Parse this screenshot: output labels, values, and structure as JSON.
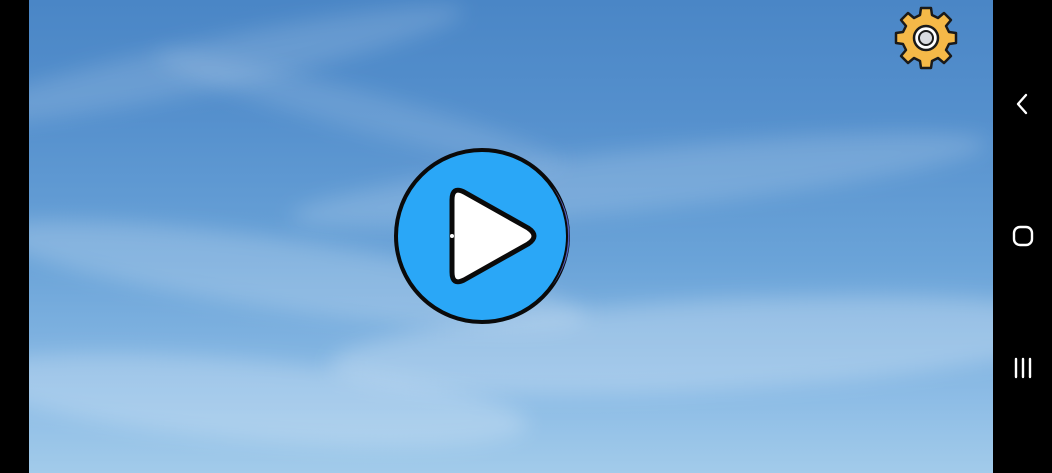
{
  "screen": {
    "background": "sky-with-clouds",
    "accent": "#2aa7f7"
  },
  "main": {
    "play_button": {
      "icon": "play-icon",
      "color": "#2aa7f7"
    },
    "settings_button": {
      "icon": "gear-icon",
      "color": "#f5b948"
    }
  },
  "navigation_bar": {
    "items": [
      {
        "icon": "back-icon"
      },
      {
        "icon": "home-icon"
      },
      {
        "icon": "recents-icon"
      }
    ]
  }
}
